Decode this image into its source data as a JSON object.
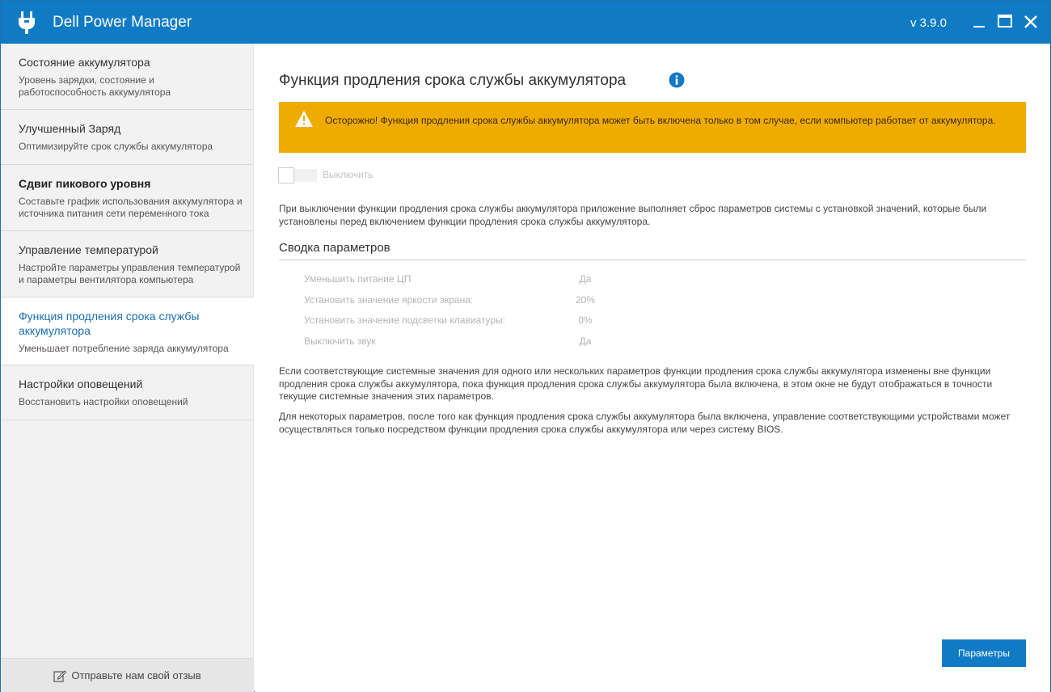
{
  "titlebar": {
    "title": "Dell Power Manager",
    "version": "v 3.9.0",
    "icons": [
      "power-plug-icon",
      "minimize-icon",
      "maximize-icon",
      "close-icon"
    ]
  },
  "sidebar": {
    "items": [
      {
        "title": "Состояние аккумулятора",
        "desc": "Уровень зарядки, состояние и работоспособность аккумулятора",
        "active": false
      },
      {
        "title": "Улучшенный Заряд",
        "desc": "Оптимизируйте срок службы аккумулятора",
        "active": false
      },
      {
        "title": "Сдвиг пикового уровня",
        "desc": "Составьте график использования аккумулятора и источника питания сети переменного тока",
        "active": false
      },
      {
        "title": "Управление температурой",
        "desc": "Настройте параметры управления температурой и параметры вентилятора компьютера",
        "active": false
      },
      {
        "title": "Функция продления срока службы аккумулятора",
        "desc": "Уменьшает потребление заряда аккумулятора",
        "active": true
      },
      {
        "title": "Настройки оповещений",
        "desc": "Восстановить настройки оповещений",
        "active": false
      }
    ],
    "feedback_label": "Отправьте нам свой отзыв"
  },
  "main": {
    "page_title": "Функция продления срока службы аккумулятора",
    "warning_text": "Осторожно! Функция продления срока службы аккумулятора может быть включена только в том случае, если компьютер работает от аккумулятора.",
    "toggle_label": "Выключить",
    "toggle_on": false,
    "para1": "При выключении функции продления срока службы аккумулятора приложение выполняет сброс параметров системы с установкой значений, которые были установлены перед включением функции продления срока службы аккумулятора.",
    "summary_title": "Сводка параметров",
    "summary": [
      {
        "label": "Уменьшить питание ЦП",
        "value": "Да"
      },
      {
        "label": "Установить значение яркости экрана:",
        "value": "20%"
      },
      {
        "label": "Установить значение подсветки клавиатуры:",
        "value": "0%"
      },
      {
        "label": "Выключить звук",
        "value": "Да"
      }
    ],
    "para2": "Если соответствующие системные значения для одного или нескольких параметров функции продления срока службы аккумулятора изменены вне функции продления срока службы аккумулятора, пока функция продления срока службы аккумулятора была включена, в этом окне не будут отображаться в точности текущие системные значения этих параметров.",
    "para3": "Для некоторых параметров, после того как функция продления срока службы аккумулятора была включена, управление соответствующими устройствами может осуществляться только посредством функции продления срока службы аккумулятора или через систему BIOS.",
    "params_button": "Параметры"
  },
  "colors": {
    "titlebar": "#0f7bc4",
    "warning": "#f0ab00",
    "active_nav_text": "#1a6fb0",
    "button": "#0f7bc4"
  }
}
